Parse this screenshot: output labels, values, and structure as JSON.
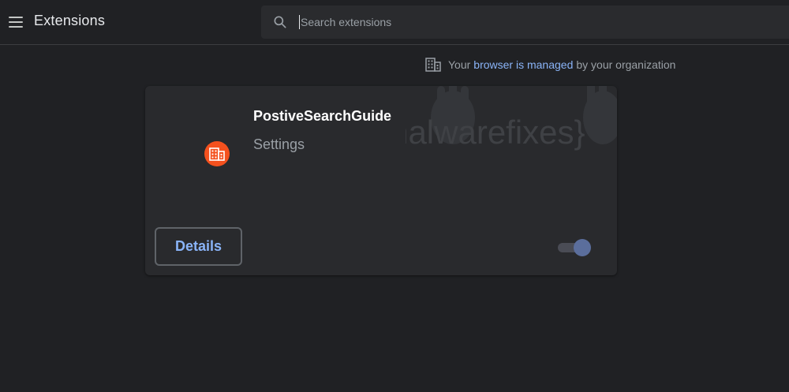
{
  "toolbar": {
    "menu_icon": "hamburger-menu-icon",
    "title": "Extensions",
    "search": {
      "icon": "search-icon",
      "placeholder": "Search extensions",
      "value": ""
    }
  },
  "managed_notice": {
    "icon": "building-icon",
    "prefix": "Your",
    "link": "browser is managed",
    "suffix": "by your organization"
  },
  "extension_card": {
    "icon": "building-icon",
    "name": "PostiveSearchGuide",
    "description": "Settings",
    "details_label": "Details",
    "enabled": true
  },
  "watermark": {
    "text": "{malwarefixes}"
  },
  "colors": {
    "background": "#202124",
    "card": "#292a2d",
    "link": "#8ab4f8",
    "extension_icon": "#f4511e",
    "toggle_knob": "#5b6e9c"
  }
}
